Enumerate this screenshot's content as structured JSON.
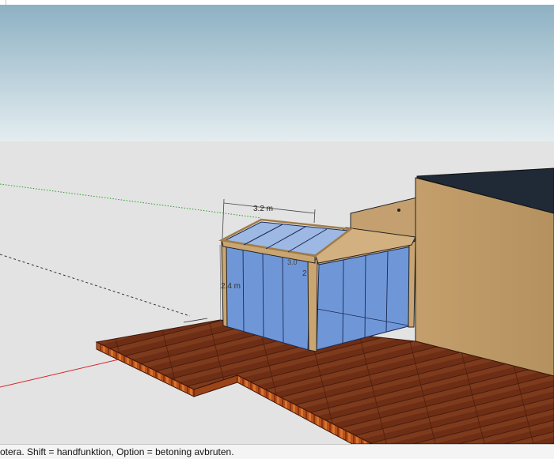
{
  "scene": {
    "dimension_width": "3.2 m",
    "dimension_height_left": "2.4 m",
    "dimension_height_right": "2",
    "dimension_back": "3.0"
  },
  "statusbar": {
    "text": "otera. Shift = handfunktion, Option = betoning avbruten."
  },
  "colors": {
    "sky_top": "#8fb3c4",
    "sky_bottom": "#e2ecef",
    "ground": "#e3e3e3",
    "deck": "#7a3519",
    "glass": "#6f97d8",
    "wall": "#c9a572",
    "roof_dark": "#1f2a36",
    "axis_red": "#d9262a",
    "axis_green": "#2aa02a"
  }
}
